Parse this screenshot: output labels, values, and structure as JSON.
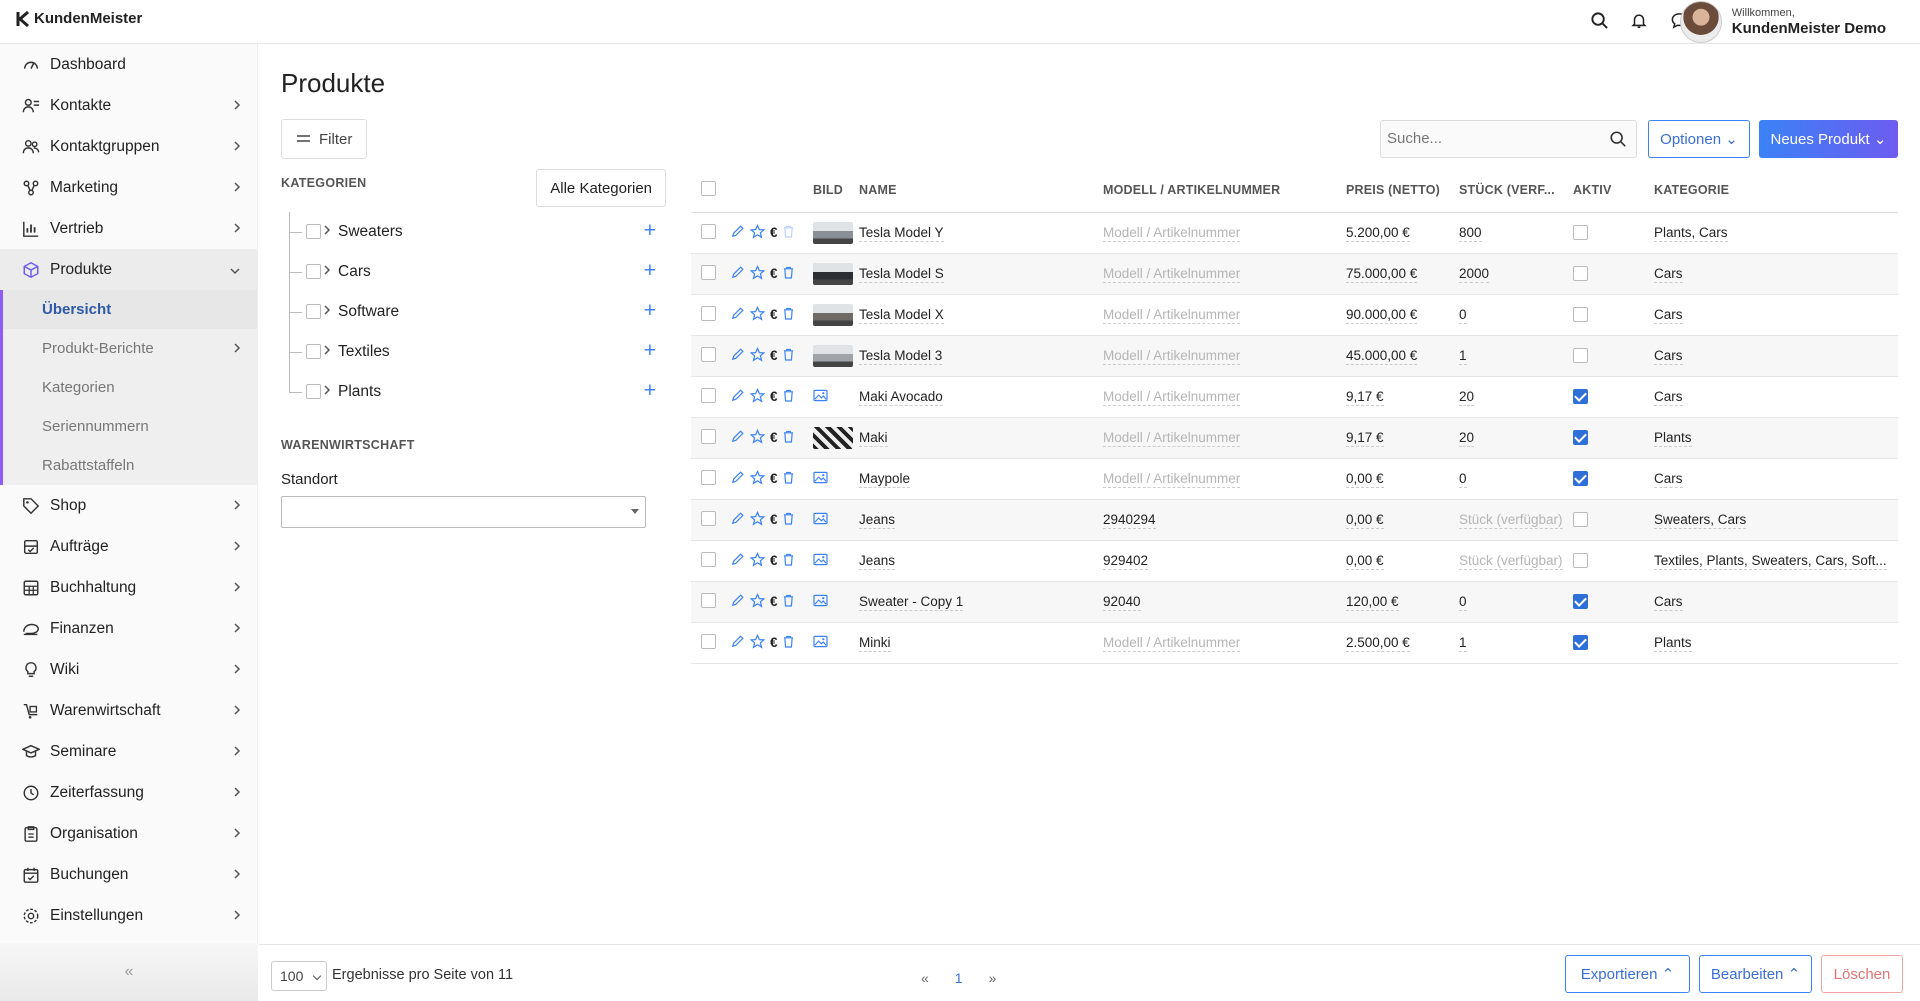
{
  "app": {
    "logo_text": "KundenMeister"
  },
  "header": {
    "welcome": "Willkommen,",
    "user_name": "KundenMeister Demo"
  },
  "sidebar": {
    "items": [
      {
        "label": "Dashboard",
        "icon": "dashboard-icon"
      },
      {
        "label": "Kontakte",
        "icon": "contacts-icon"
      },
      {
        "label": "Kontaktgruppen",
        "icon": "contact-groups-icon"
      },
      {
        "label": "Marketing",
        "icon": "marketing-icon"
      },
      {
        "label": "Vertrieb",
        "icon": "sales-chart-icon"
      },
      {
        "label": "Produkte",
        "icon": "product-box-icon"
      },
      {
        "label": "Shop",
        "icon": "shop-tag-icon"
      },
      {
        "label": "Aufträge",
        "icon": "orders-icon"
      },
      {
        "label": "Buchhaltung",
        "icon": "accounting-icon"
      },
      {
        "label": "Finanzen",
        "icon": "finance-icon"
      },
      {
        "label": "Wiki",
        "icon": "wiki-bulb-icon"
      },
      {
        "label": "Warenwirtschaft",
        "icon": "inventory-icon"
      },
      {
        "label": "Seminare",
        "icon": "seminar-icon"
      },
      {
        "label": "Zeiterfassung",
        "icon": "clock-icon"
      },
      {
        "label": "Organisation",
        "icon": "organisation-icon"
      },
      {
        "label": "Buchungen",
        "icon": "calendar-icon"
      },
      {
        "label": "Einstellungen",
        "icon": "settings-gear-icon"
      }
    ],
    "sub_items": [
      {
        "label": "Übersicht"
      },
      {
        "label": "Produkt-Berichte"
      },
      {
        "label": "Kategorien"
      },
      {
        "label": "Seriennummern"
      },
      {
        "label": "Rabattstaffeln"
      }
    ],
    "collapse_label": "«"
  },
  "page": {
    "title": "Produkte"
  },
  "filter": {
    "label": "Filter"
  },
  "categories": {
    "title": "KATEGORIEN",
    "all_button": "Alle Kategorien",
    "items": [
      {
        "label": "Sweaters"
      },
      {
        "label": "Cars"
      },
      {
        "label": "Software"
      },
      {
        "label": "Textiles"
      },
      {
        "label": "Plants"
      }
    ]
  },
  "warehouse": {
    "title": "WARENWIRTSCHAFT",
    "location_label": "Standort"
  },
  "search": {
    "placeholder": "Suche..."
  },
  "buttons": {
    "options": "Optionen",
    "new_product": "Neues Produkt"
  },
  "table": {
    "columns": {
      "image": "BILD",
      "name": "NAME",
      "model": "MODELL / ARTIKELNUMMER",
      "price": "PREIS (NETTO)",
      "stock": "STÜCK (VERF...",
      "active": "AKTIV",
      "category": "KATEGORIE"
    },
    "rows": [
      {
        "name": "Tesla Model Y",
        "model": "Modell / Artikelnummer",
        "price": "5.200,00 €",
        "stock": "800",
        "active": false,
        "category": "Plants, Cars"
      },
      {
        "name": "Tesla Model S",
        "model": "Modell / Artikelnummer",
        "price": "75.000,00 €",
        "stock": "2000",
        "active": false,
        "category": "Cars"
      },
      {
        "name": "Tesla Model X",
        "model": "Modell / Artikelnummer",
        "price": "90.000,00 €",
        "stock": "0",
        "active": false,
        "category": "Cars"
      },
      {
        "name": "Tesla Model 3",
        "model": "Modell / Artikelnummer",
        "price": "45.000,00 €",
        "stock": "1",
        "active": false,
        "category": "Cars"
      },
      {
        "name": "Maki Avocado",
        "model": "Modell / Artikelnummer",
        "price": "9,17 €",
        "stock": "20",
        "active": true,
        "category": "Cars"
      },
      {
        "name": "Maki",
        "model": "Modell / Artikelnummer",
        "price": "9,17 €",
        "stock": "20",
        "active": true,
        "category": "Plants"
      },
      {
        "name": "Maypole",
        "model": "Modell / Artikelnummer",
        "price": "0,00 €",
        "stock": "0",
        "active": true,
        "category": "Cars"
      },
      {
        "name": "Jeans",
        "model": "2940294",
        "price": "0,00 €",
        "stock": "Stück (verfügbar)",
        "active": false,
        "category": "Sweaters, Cars"
      },
      {
        "name": "Jeans",
        "model": "929402",
        "price": "0,00 €",
        "stock": "Stück (verfügbar)",
        "active": false,
        "category": "Textiles, Plants, Sweaters, Cars, Soft..."
      },
      {
        "name": "Sweater - Copy 1",
        "model": "92040",
        "price": "120,00 €",
        "stock": "0",
        "active": true,
        "category": "Cars"
      },
      {
        "name": "Minki",
        "model": "Modell / Artikelnummer",
        "price": "2.500,00 €",
        "stock": "1",
        "active": true,
        "category": "Plants"
      }
    ],
    "row_icons": {
      "edit": "pencil-edit-icon",
      "favorite": "star-icon",
      "price": "euro-icon",
      "delete": "trash-icon",
      "image": "image-icon"
    },
    "euro_symbol": "€",
    "thumb_colors": [
      "#8a8f95",
      "#2b2f33",
      "#6f6b66",
      "#a0a4a8",
      "#3a3a3a"
    ]
  },
  "footer": {
    "per_page": "100",
    "results_text": "Ergebnisse pro Seite von 11",
    "prev": "«",
    "page": "1",
    "next": "»",
    "export": "Exportieren",
    "edit": "Bearbeiten",
    "delete": "Löschen"
  },
  "colors": {
    "accent": "#3b82f6",
    "brand_purple": "#6d5cf0",
    "danger": "#e57373"
  }
}
